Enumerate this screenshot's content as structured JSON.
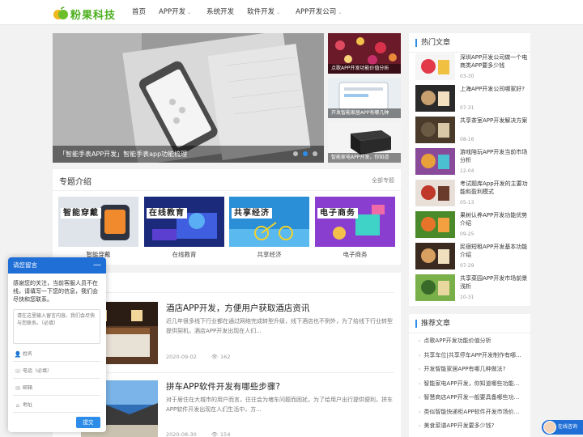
{
  "brand": {
    "name": "粉果科技",
    "color": "#4caf1f"
  },
  "nav": {
    "items": [
      {
        "label": "首页",
        "dropdown": false
      },
      {
        "label": "APP开发",
        "dropdown": true
      },
      {
        "label": "系统开发",
        "dropdown": false
      },
      {
        "label": "软件开发",
        "dropdown": true
      },
      {
        "label": "APP开发公司",
        "dropdown": true
      }
    ]
  },
  "slider": {
    "caption": "「智能手表APP开发」智能手表app功能梳理",
    "slide_count": 3,
    "active_slide": 2,
    "side": [
      {
        "caption": "点歌APP开发功能价值分析"
      },
      {
        "caption": "开发智能家居APP有哪几种"
      },
      {
        "caption": "智能家电APP开发，你知道"
      }
    ]
  },
  "topics": {
    "title": "专题介绍",
    "more": "全部专题",
    "items": [
      {
        "banner": "智能穿戴",
        "label": "智能穿戴"
      },
      {
        "banner": "在线教育",
        "label": "在线教育"
      },
      {
        "banner": "共享经济",
        "label": "共享经济"
      },
      {
        "banner": "电子商务",
        "label": "电子商务"
      }
    ]
  },
  "articles": [
    {
      "title": "酒店APP开发，方便用户获取酒店资讯",
      "excerpt": "近几年很多线下行业都在通过网络完成转型升级，线下酒店也不例外，为了给线下行业转型提供契机，酒店APP开发出现在人们...",
      "date": "2020-09-02",
      "views": "162"
    },
    {
      "title": "拼车APP软件开发有哪些步骤?",
      "excerpt": "对于居住在大城市的用户而言，往往会为堵车问题而困扰，为了给用户出行提供便利，拼车APP软件开发出现在人们生活中，方...",
      "date": "2020-08-30",
      "views": "154"
    }
  ],
  "hot": {
    "title": "热门文章",
    "items": [
      {
        "title": "深圳APP开发公司做一个电商类APP要多少钱",
        "date": "03-30"
      },
      {
        "title": "上海APP开发公司哪家好?",
        "date": "07-31"
      },
      {
        "title": "共享茶室APP开发解决方案",
        "date": "08-16"
      },
      {
        "title": "游戏陪玩APP开发当前市场分析",
        "date": "12-04"
      },
      {
        "title": "考试题库App开发的主要功能和盈利模式",
        "date": "05-13"
      },
      {
        "title": "果树认养APP开发功能优势介绍",
        "date": "09-25"
      },
      {
        "title": "民宿短租APP开发基本功能介绍",
        "date": "07-29"
      },
      {
        "title": "共享菜园APP开发市场前景浅析",
        "date": "10-31"
      }
    ]
  },
  "recommend": {
    "title": "推荐文章",
    "items": [
      "点歌APP开发功能价值分析",
      "共享车位|共享停车APP开发制作有哪...",
      "开发智能家居APP有哪几种做法?",
      "智能家电APP开发，你知道哪些功能...",
      "智慧商店APP开发一般要具备哪些功...",
      "类似智能快递柜APP软件开发市场价...",
      "美食菜谱APP开发要多少钱?"
    ]
  },
  "chat": {
    "title": "请您留言",
    "minimize": "—",
    "intro": "感谢您的关注，当前客服人员不在线，请填写一下您的信息，我们会尽快和您联系。",
    "message_placeholder": "请在这里输入留言内容，我们会尽快与您联系。（必填）",
    "name_placeholder": "姓名",
    "phone_placeholder": "电话（必填）",
    "email_placeholder": "邮箱",
    "address_placeholder": "地址",
    "submit": "提交"
  },
  "online_service": {
    "label": "在线咨询"
  },
  "colors": {
    "accent": "#2c8ce8",
    "chat_header": "#1f6fd6"
  }
}
